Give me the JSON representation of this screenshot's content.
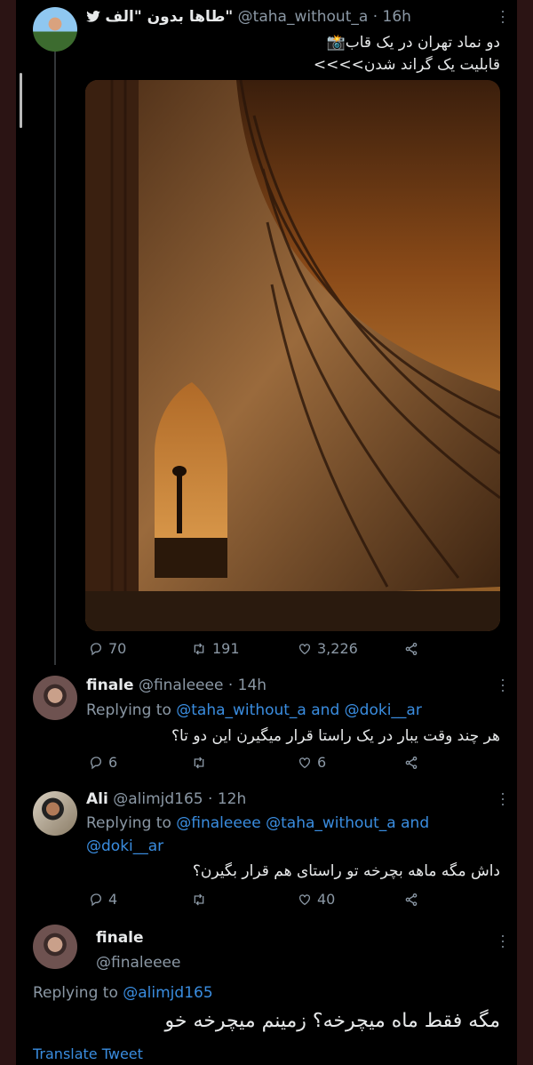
{
  "tweet": {
    "author_name": "طاها بدون \"الف\"",
    "handle": "@taha_without_a",
    "time": "16h",
    "text_line1": "دو نماد تهران در یک قاب📸",
    "text_line2": "قابلیت یک گراند شدن>>>>",
    "replies": "70",
    "retweets": "191",
    "likes": "3,226"
  },
  "replies": [
    {
      "name": "finale",
      "handle": "@finaleeee",
      "time": "14h",
      "replying_label": "Replying to",
      "replying_to_1": "@taha_without_a",
      "conjunction": "and",
      "replying_to_2": "@doki__ar",
      "text": "هر چند وقت یبار در یک راستا قرار میگیرن این دو تا؟",
      "replies": "6",
      "retweets": "",
      "likes": "6"
    },
    {
      "name": "Ali",
      "handle": "@alimjd165",
      "time": "12h",
      "replying_label": "Replying to",
      "replying_to_1": "@finaleeee",
      "replying_to_2": "@taha_without_a",
      "conjunction": "and",
      "replying_to_3": "@doki__ar",
      "text": "داش مگه ماهه بچرخه تو راستای هم قرار بگیرن؟",
      "replies": "4",
      "retweets": "",
      "likes": "40"
    }
  ],
  "focused": {
    "name": "finale",
    "handle": "@finaleeee",
    "replying_label": "Replying to",
    "replying_to": "@alimjd165",
    "text": "مگه فقط ماه میچرخه؟ زمینم میچرخه خو",
    "translate": "Translate Tweet"
  },
  "icons": [
    "reply-icon",
    "retweet-icon",
    "like-icon",
    "share-icon",
    "more-icon",
    "twitter-bird-icon",
    "camera-icon"
  ]
}
